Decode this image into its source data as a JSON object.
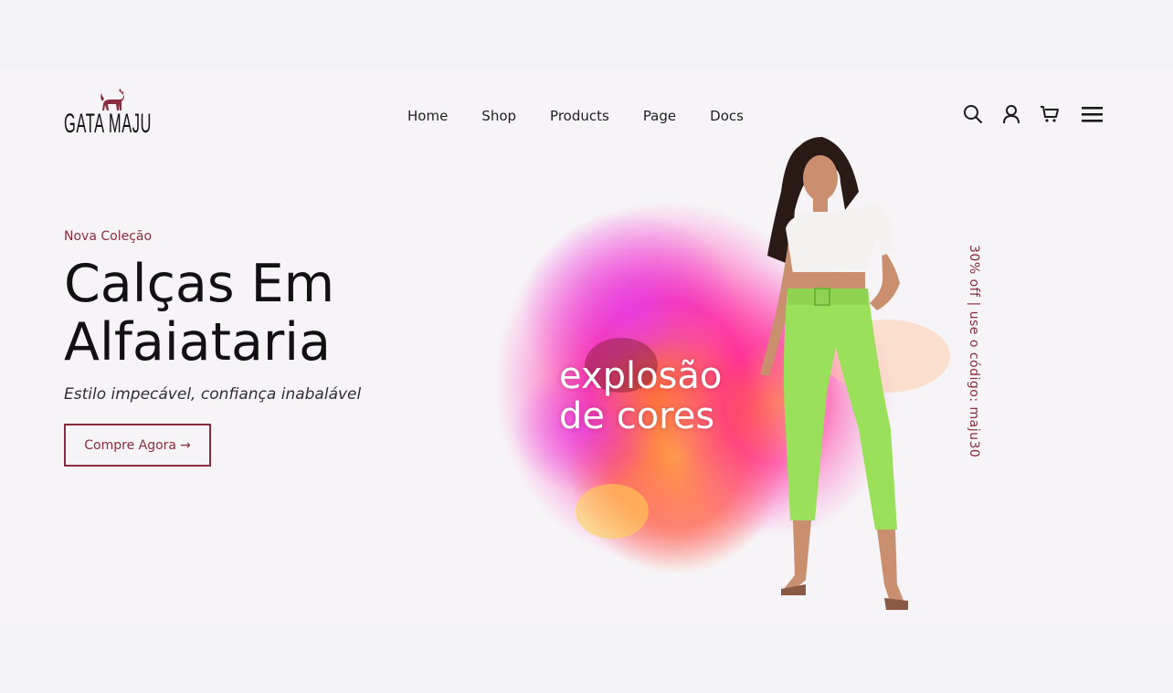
{
  "brand": {
    "name": "GATA MAJU",
    "accent": "#8b2c3e"
  },
  "nav": {
    "items": [
      {
        "label": "Home"
      },
      {
        "label": "Shop"
      },
      {
        "label": "Products"
      },
      {
        "label": "Page"
      },
      {
        "label": "Docs"
      }
    ]
  },
  "header_icons": [
    "search-icon",
    "user-icon",
    "cart-icon",
    "menu-icon"
  ],
  "hero": {
    "eyebrow": "Nova Coleção",
    "title_line1": "Calças Em",
    "title_line2": "Alfaiataria",
    "subtitle": "Estilo impecável, confiança inabalável",
    "cta_label": "Compre Agora",
    "cta_arrow": "→",
    "burst_line1": "explosão",
    "burst_line2": "de cores",
    "promo": "30% off | use o código: maju30"
  }
}
